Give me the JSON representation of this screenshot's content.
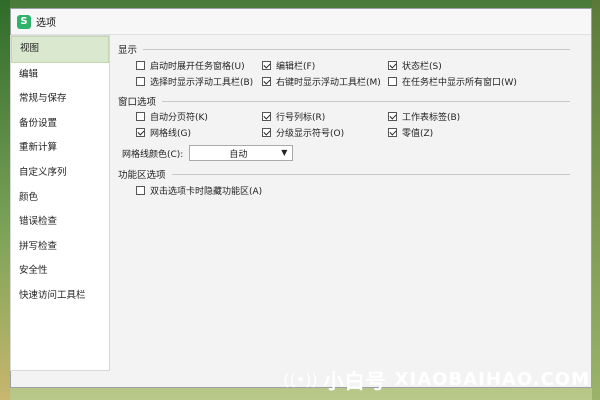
{
  "window": {
    "title": "选项",
    "app_icon": "S"
  },
  "sidebar": {
    "items": [
      {
        "label": "视图",
        "active": true
      },
      {
        "label": "编辑"
      },
      {
        "label": "常规与保存"
      },
      {
        "label": "备份设置"
      },
      {
        "label": "重新计算"
      },
      {
        "label": "自定义序列"
      },
      {
        "label": "颜色"
      },
      {
        "label": "错误检查"
      },
      {
        "label": "拼写检查"
      },
      {
        "label": "安全性"
      },
      {
        "label": "快速访问工具栏"
      }
    ]
  },
  "display": {
    "title": "显示",
    "options": [
      {
        "label": "启动时展开任务窗格(U)",
        "checked": false
      },
      {
        "label": "编辑栏(F)",
        "checked": true
      },
      {
        "label": "状态栏(S)",
        "checked": true
      },
      {
        "label": "选择时显示浮动工具栏(B)",
        "checked": false
      },
      {
        "label": "右键时显示浮动工具栏(M)",
        "checked": true
      },
      {
        "label": "在任务栏中显示所有窗口(W)",
        "checked": false
      }
    ]
  },
  "window_options": {
    "title": "窗口选项",
    "options": [
      {
        "label": "自动分页符(K)",
        "checked": false
      },
      {
        "label": "行号列标(R)",
        "checked": true
      },
      {
        "label": "工作表标签(B)",
        "checked": true
      },
      {
        "label": "网格线(G)",
        "checked": true
      },
      {
        "label": "分级显示符号(O)",
        "checked": true
      },
      {
        "label": "零值(Z)",
        "checked": true
      }
    ],
    "grid_color_label": "网格线颜色(C):",
    "grid_color_value": "自动"
  },
  "ribbon": {
    "title": "功能区选项",
    "options": [
      {
        "label": "双击选项卡时隐藏功能区(A)",
        "checked": false
      }
    ]
  },
  "watermark": {
    "cn": "小白号",
    "en": "XIAOBAIHAO.COM"
  },
  "colors": {
    "active_nav": "#dbe8d0",
    "app_icon": "#2fb26a"
  }
}
